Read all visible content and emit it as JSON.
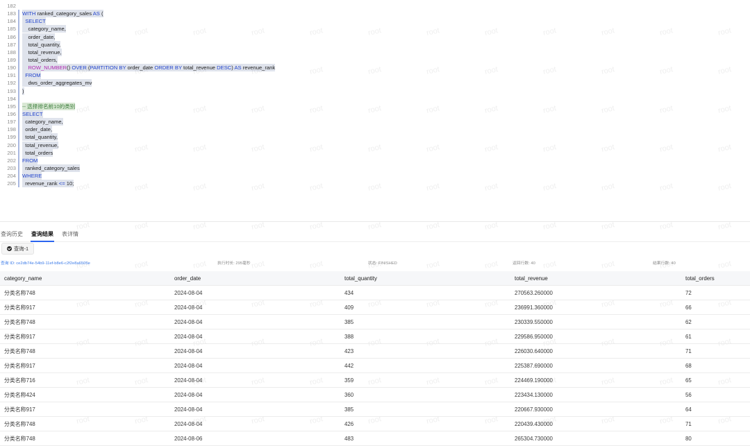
{
  "editor": {
    "line_numbers": [
      "182",
      "183",
      "184",
      "185",
      "186",
      "187",
      "188",
      "189",
      "190",
      "191",
      "192",
      "193",
      "194",
      "195",
      "196",
      "197",
      "198",
      "199",
      "200",
      "201",
      "202",
      "203",
      "204",
      "205"
    ],
    "lines": [
      [],
      [
        {
          "t": "WITH",
          "c": "kw"
        },
        {
          "t": " ranked_category_sales "
        },
        {
          "t": "AS",
          "c": "kw"
        },
        {
          "t": " ("
        }
      ],
      [
        {
          "t": "  "
        },
        {
          "t": "SELECT",
          "c": "kw"
        }
      ],
      [
        {
          "t": "    category_name,"
        }
      ],
      [
        {
          "t": "    order_date,"
        }
      ],
      [
        {
          "t": "    total_quantity,"
        }
      ],
      [
        {
          "t": "    total_revenue,"
        }
      ],
      [
        {
          "t": "    total_orders,"
        }
      ],
      [
        {
          "t": "    "
        },
        {
          "t": "ROW_NUMBER",
          "c": "fn"
        },
        {
          "t": "() "
        },
        {
          "t": "OVER",
          "c": "kw"
        },
        {
          "t": " ("
        },
        {
          "t": "PARTITION BY",
          "c": "kw"
        },
        {
          "t": " order_date "
        },
        {
          "t": "ORDER BY",
          "c": "kw"
        },
        {
          "t": " total_revenue "
        },
        {
          "t": "DESC",
          "c": "kw"
        },
        {
          "t": ") "
        },
        {
          "t": "AS",
          "c": "kw"
        },
        {
          "t": " revenue_rank"
        }
      ],
      [
        {
          "t": "  "
        },
        {
          "t": "FROM",
          "c": "kw"
        }
      ],
      [
        {
          "t": "    dws_order_aggregates_mv"
        }
      ],
      [
        {
          "t": ")"
        }
      ],
      [],
      [
        {
          "t": "-- 选择排名前10的类别",
          "c": "cm"
        }
      ],
      [
        {
          "t": "SELECT",
          "c": "kw"
        }
      ],
      [
        {
          "t": "  category_name,"
        }
      ],
      [
        {
          "t": "  order_date,"
        }
      ],
      [
        {
          "t": "  total_quantity,"
        }
      ],
      [
        {
          "t": "  total_revenue,"
        }
      ],
      [
        {
          "t": "  total_orders"
        }
      ],
      [
        {
          "t": "FROM",
          "c": "kw"
        }
      ],
      [
        {
          "t": "  ranked_category_sales"
        }
      ],
      [
        {
          "t": "WHERE",
          "c": "kw"
        }
      ],
      [
        {
          "t": "  revenue_rank "
        },
        {
          "t": "<=",
          "c": "kw"
        },
        {
          "t": " 10;"
        }
      ]
    ],
    "watermark": "root"
  },
  "tabs": [
    {
      "label": "查询历史",
      "active": false
    },
    {
      "label": "查询结果",
      "active": true
    },
    {
      "label": "表详情",
      "active": false
    }
  ],
  "query_button": {
    "label": "查询-1",
    "icon": "check-circle-icon"
  },
  "info": {
    "query_id": "查询 ID: ce2db74e-54b9-11ef-b8e6-c2f2e8a6505e",
    "exec_time": "执行时长: 295毫秒",
    "status": "状态: FINISHED",
    "returned_rows": "返回行数: 40",
    "result_rows": "结果行数: 40"
  },
  "table": {
    "columns": [
      "category_name",
      "order_date",
      "total_quantity",
      "total_revenue",
      "total_orders"
    ],
    "rows": [
      [
        "分类名称748",
        "2024-08-04",
        "434",
        "270563.260000",
        "72"
      ],
      [
        "分类名称917",
        "2024-08-04",
        "409",
        "236991.360000",
        "66"
      ],
      [
        "分类名称748",
        "2024-08-04",
        "385",
        "230339.550000",
        "62"
      ],
      [
        "分类名称917",
        "2024-08-04",
        "388",
        "229586.950000",
        "61"
      ],
      [
        "分类名称748",
        "2024-08-04",
        "423",
        "226030.640000",
        "71"
      ],
      [
        "分类名称917",
        "2024-08-04",
        "442",
        "225387.690000",
        "68"
      ],
      [
        "分类名称716",
        "2024-08-04",
        "359",
        "224469.190000",
        "65"
      ],
      [
        "分类名称424",
        "2024-08-04",
        "360",
        "223434.130000",
        "56"
      ],
      [
        "分类名称917",
        "2024-08-04",
        "385",
        "220667.930000",
        "64"
      ],
      [
        "分类名称748",
        "2024-08-04",
        "426",
        "220439.430000",
        "71"
      ],
      [
        "分类名称748",
        "2024-08-06",
        "483",
        "265304.730000",
        "80"
      ]
    ]
  }
}
